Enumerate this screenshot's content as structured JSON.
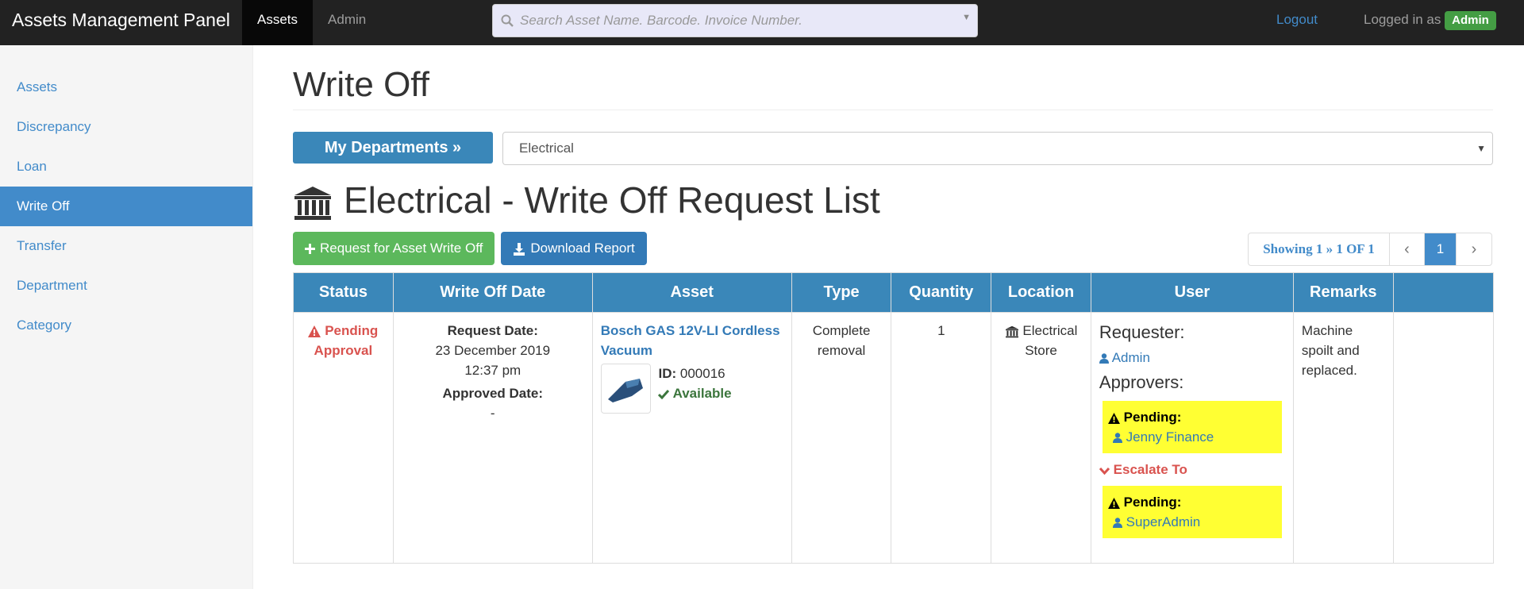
{
  "app": {
    "title": "Assets Management Panel"
  },
  "nav": {
    "tabs": [
      {
        "label": "Assets"
      },
      {
        "label": "Admin"
      }
    ],
    "search_placeholder": "Search Asset Name. Barcode. Invoice Number.",
    "logout": "Logout",
    "logged_in_as": "Logged in as",
    "user_badge": "Admin"
  },
  "sidebar": {
    "items": [
      {
        "label": "Assets"
      },
      {
        "label": "Discrepancy"
      },
      {
        "label": "Loan"
      },
      {
        "label": "Write Off"
      },
      {
        "label": "Transfer"
      },
      {
        "label": "Department"
      },
      {
        "label": "Category"
      }
    ]
  },
  "main": {
    "title": "Write Off",
    "dept_button": "My Departments »",
    "dept_selected": "Electrical",
    "list_title": "Electrical - Write Off Request List",
    "request_button": "Request for Asset Write Off",
    "download_button": "Download Report",
    "pager": {
      "info": "Showing 1 » 1 OF 1",
      "current": "1"
    }
  },
  "table": {
    "headers": [
      "Status",
      "Write Off Date",
      "Asset",
      "Type",
      "Quantity",
      "Location",
      "User",
      "Remarks",
      ""
    ],
    "row": {
      "status": "Pending Approval",
      "request_date_label": "Request Date:",
      "request_date": "23 December 2019",
      "request_time": "12:37 pm",
      "approved_date_label": "Approved Date:",
      "approved_date": "-",
      "asset_name": "Bosch GAS 12V-LI Cordless Vacuum",
      "asset_id_label": "ID:",
      "asset_id": "000016",
      "asset_status": "Available",
      "type": "Complete removal",
      "quantity": "1",
      "location": "Electrical Store",
      "requester_label": "Requester:",
      "requester": "Admin",
      "approvers_label": "Approvers:",
      "pending_label": "Pending:",
      "approver": "Jenny Finance",
      "escalate_label": "Escalate To",
      "escalate_pending_label": "Pending:",
      "escalate_user": "SuperAdmin",
      "remarks": "Machine spoilt and replaced."
    }
  },
  "colors": {
    "navbar": "#222222",
    "primary": "#428bca",
    "table_header": "#3a87b9",
    "success": "#5cb85c",
    "danger": "#d9534f",
    "highlight": "#ffff33"
  },
  "icons": [
    "search-icon",
    "bank-icon",
    "plus-icon",
    "download-icon",
    "warning-icon",
    "check-icon",
    "user-icon",
    "chevron-down-icon",
    "chevron-left-icon",
    "chevron-right-icon"
  ]
}
